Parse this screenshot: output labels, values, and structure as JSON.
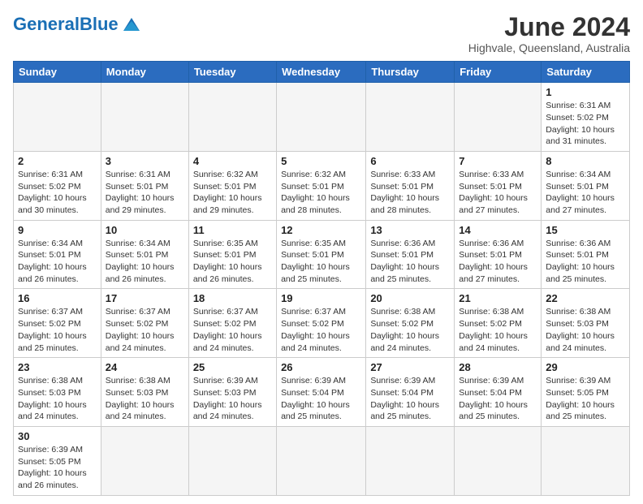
{
  "logo": {
    "text_black": "General",
    "text_blue": "Blue"
  },
  "header": {
    "month_title": "June 2024",
    "subtitle": "Highvale, Queensland, Australia"
  },
  "days_of_week": [
    "Sunday",
    "Monday",
    "Tuesday",
    "Wednesday",
    "Thursday",
    "Friday",
    "Saturday"
  ],
  "weeks": [
    [
      {
        "day": "",
        "info": "",
        "empty": true
      },
      {
        "day": "",
        "info": "",
        "empty": true
      },
      {
        "day": "",
        "info": "",
        "empty": true
      },
      {
        "day": "",
        "info": "",
        "empty": true
      },
      {
        "day": "",
        "info": "",
        "empty": true
      },
      {
        "day": "",
        "info": "",
        "empty": true
      },
      {
        "day": "1",
        "info": "Sunrise: 6:31 AM\nSunset: 5:02 PM\nDaylight: 10 hours\nand 31 minutes."
      }
    ],
    [
      {
        "day": "2",
        "info": "Sunrise: 6:31 AM\nSunset: 5:02 PM\nDaylight: 10 hours\nand 30 minutes."
      },
      {
        "day": "3",
        "info": "Sunrise: 6:31 AM\nSunset: 5:01 PM\nDaylight: 10 hours\nand 29 minutes."
      },
      {
        "day": "4",
        "info": "Sunrise: 6:32 AM\nSunset: 5:01 PM\nDaylight: 10 hours\nand 29 minutes."
      },
      {
        "day": "5",
        "info": "Sunrise: 6:32 AM\nSunset: 5:01 PM\nDaylight: 10 hours\nand 28 minutes."
      },
      {
        "day": "6",
        "info": "Sunrise: 6:33 AM\nSunset: 5:01 PM\nDaylight: 10 hours\nand 28 minutes."
      },
      {
        "day": "7",
        "info": "Sunrise: 6:33 AM\nSunset: 5:01 PM\nDaylight: 10 hours\nand 27 minutes."
      },
      {
        "day": "8",
        "info": "Sunrise: 6:34 AM\nSunset: 5:01 PM\nDaylight: 10 hours\nand 27 minutes."
      }
    ],
    [
      {
        "day": "9",
        "info": "Sunrise: 6:34 AM\nSunset: 5:01 PM\nDaylight: 10 hours\nand 26 minutes."
      },
      {
        "day": "10",
        "info": "Sunrise: 6:34 AM\nSunset: 5:01 PM\nDaylight: 10 hours\nand 26 minutes."
      },
      {
        "day": "11",
        "info": "Sunrise: 6:35 AM\nSunset: 5:01 PM\nDaylight: 10 hours\nand 26 minutes."
      },
      {
        "day": "12",
        "info": "Sunrise: 6:35 AM\nSunset: 5:01 PM\nDaylight: 10 hours\nand 25 minutes."
      },
      {
        "day": "13",
        "info": "Sunrise: 6:36 AM\nSunset: 5:01 PM\nDaylight: 10 hours\nand 25 minutes."
      },
      {
        "day": "14",
        "info": "Sunrise: 6:36 AM\nSunset: 5:01 PM\nDaylight: 10 hours\nand 27 minutes."
      },
      {
        "day": "15",
        "info": "Sunrise: 6:36 AM\nSunset: 5:01 PM\nDaylight: 10 hours\nand 25 minutes."
      }
    ],
    [
      {
        "day": "16",
        "info": "Sunrise: 6:37 AM\nSunset: 5:02 PM\nDaylight: 10 hours\nand 25 minutes."
      },
      {
        "day": "17",
        "info": "Sunrise: 6:37 AM\nSunset: 5:02 PM\nDaylight: 10 hours\nand 24 minutes."
      },
      {
        "day": "18",
        "info": "Sunrise: 6:37 AM\nSunset: 5:02 PM\nDaylight: 10 hours\nand 24 minutes."
      },
      {
        "day": "19",
        "info": "Sunrise: 6:37 AM\nSunset: 5:02 PM\nDaylight: 10 hours\nand 24 minutes."
      },
      {
        "day": "20",
        "info": "Sunrise: 6:38 AM\nSunset: 5:02 PM\nDaylight: 10 hours\nand 24 minutes."
      },
      {
        "day": "21",
        "info": "Sunrise: 6:38 AM\nSunset: 5:02 PM\nDaylight: 10 hours\nand 24 minutes."
      },
      {
        "day": "22",
        "info": "Sunrise: 6:38 AM\nSunset: 5:03 PM\nDaylight: 10 hours\nand 24 minutes."
      }
    ],
    [
      {
        "day": "23",
        "info": "Sunrise: 6:38 AM\nSunset: 5:03 PM\nDaylight: 10 hours\nand 24 minutes."
      },
      {
        "day": "24",
        "info": "Sunrise: 6:38 AM\nSunset: 5:03 PM\nDaylight: 10 hours\nand 24 minutes."
      },
      {
        "day": "25",
        "info": "Sunrise: 6:39 AM\nSunset: 5:03 PM\nDaylight: 10 hours\nand 24 minutes."
      },
      {
        "day": "26",
        "info": "Sunrise: 6:39 AM\nSunset: 5:04 PM\nDaylight: 10 hours\nand 25 minutes."
      },
      {
        "day": "27",
        "info": "Sunrise: 6:39 AM\nSunset: 5:04 PM\nDaylight: 10 hours\nand 25 minutes."
      },
      {
        "day": "28",
        "info": "Sunrise: 6:39 AM\nSunset: 5:04 PM\nDaylight: 10 hours\nand 25 minutes."
      },
      {
        "day": "29",
        "info": "Sunrise: 6:39 AM\nSunset: 5:05 PM\nDaylight: 10 hours\nand 25 minutes."
      }
    ],
    [
      {
        "day": "30",
        "info": "Sunrise: 6:39 AM\nSunset: 5:05 PM\nDaylight: 10 hours\nand 26 minutes."
      },
      {
        "day": "",
        "info": "",
        "empty": true
      },
      {
        "day": "",
        "info": "",
        "empty": true
      },
      {
        "day": "",
        "info": "",
        "empty": true
      },
      {
        "day": "",
        "info": "",
        "empty": true
      },
      {
        "day": "",
        "info": "",
        "empty": true
      },
      {
        "day": "",
        "info": "",
        "empty": true
      }
    ]
  ]
}
